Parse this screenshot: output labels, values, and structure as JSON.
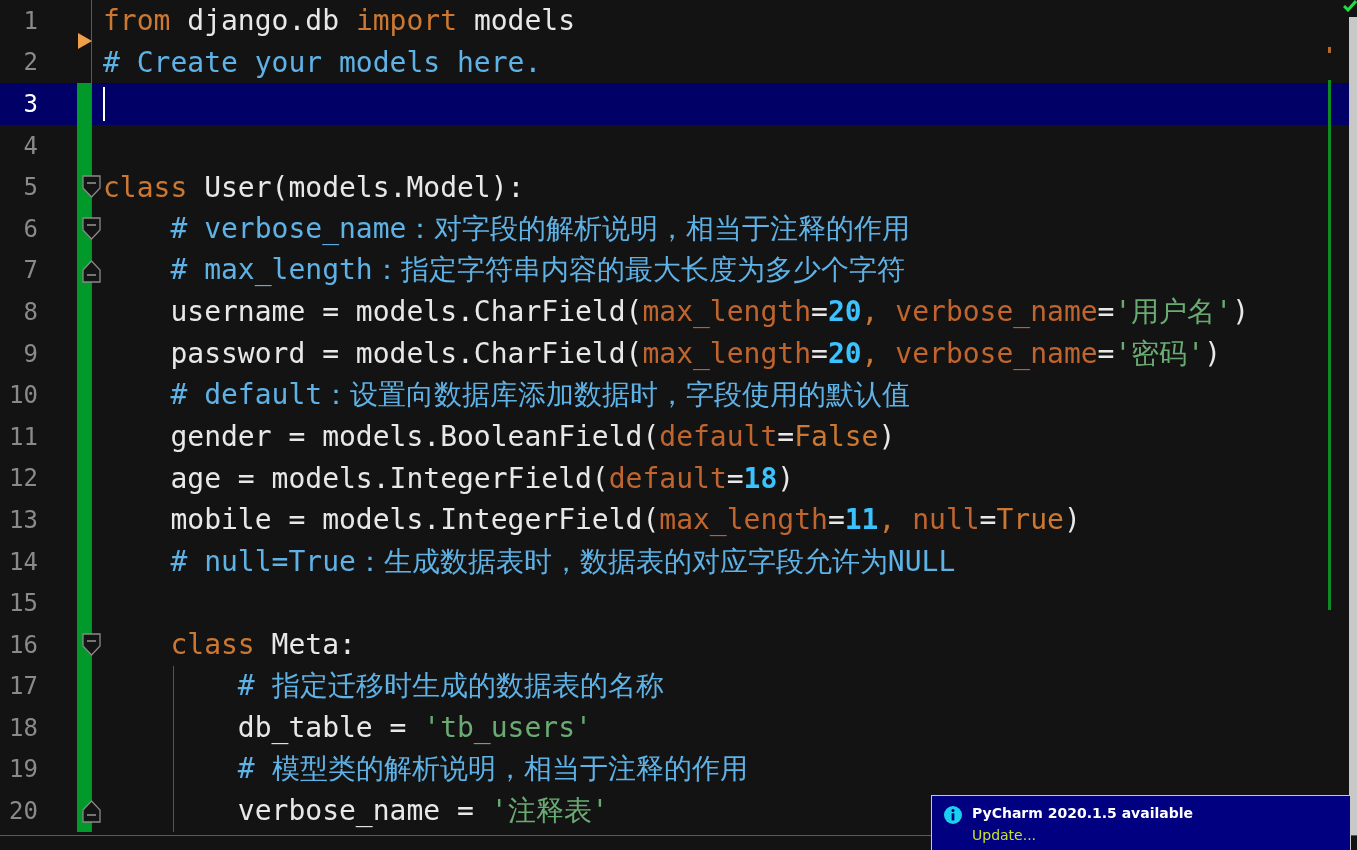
{
  "lines": [
    {
      "number": "1",
      "current": false,
      "changed": false,
      "fold_start": false,
      "fold_end": false,
      "guide": false,
      "tokens": [
        {
          "kind": "kw",
          "text": "from"
        },
        {
          "kind": "plain",
          "text": " django.db "
        },
        {
          "kind": "kw",
          "text": "import"
        },
        {
          "kind": "plain",
          "text": " models"
        }
      ]
    },
    {
      "number": "2",
      "current": false,
      "changed": false,
      "fold_start": false,
      "fold_end": false,
      "guide": false,
      "tokens": [
        {
          "kind": "cmt",
          "text": "# Create your models here."
        }
      ]
    },
    {
      "number": "3",
      "current": true,
      "changed": true,
      "fold_start": false,
      "fold_end": false,
      "guide": false
    },
    {
      "number": "4",
      "current": false,
      "changed": true,
      "fold_start": false,
      "fold_end": false,
      "guide": false
    },
    {
      "number": "5",
      "current": false,
      "changed": true,
      "fold_start": true,
      "fold_end": false,
      "guide": false,
      "tokens": [
        {
          "kind": "kw",
          "text": "class"
        },
        {
          "kind": "plain",
          "text": " User(models.Model):"
        }
      ]
    },
    {
      "number": "6",
      "current": false,
      "changed": true,
      "fold_start": true,
      "fold_end": false,
      "guide": false,
      "tokens": [
        {
          "kind": "cmt",
          "text": "    # verbose_name：对字段的解析说明，相当于注释的作用"
        }
      ]
    },
    {
      "number": "7",
      "current": false,
      "changed": true,
      "fold_start": false,
      "fold_end": true,
      "guide": false,
      "tokens": [
        {
          "kind": "cmt",
          "text": "    # max_length：指定字符串内容的最大长度为多少个字符"
        }
      ]
    },
    {
      "number": "8",
      "current": false,
      "changed": true,
      "fold_start": false,
      "fold_end": false,
      "guide": false,
      "tokens": [
        {
          "kind": "plain",
          "text": "    username = models.CharField("
        },
        {
          "kind": "param",
          "text": "max_length"
        },
        {
          "kind": "plain",
          "text": "="
        },
        {
          "kind": "num",
          "text": "20"
        },
        {
          "kind": "kw",
          "text": ", "
        },
        {
          "kind": "param",
          "text": "verbose_name"
        },
        {
          "kind": "plain",
          "text": "="
        },
        {
          "kind": "str",
          "text": "'用户名'"
        },
        {
          "kind": "plain",
          "text": ")"
        }
      ]
    },
    {
      "number": "9",
      "current": false,
      "changed": true,
      "fold_start": false,
      "fold_end": false,
      "guide": false,
      "tokens": [
        {
          "kind": "plain",
          "text": "    password = models.CharField("
        },
        {
          "kind": "param",
          "text": "max_length"
        },
        {
          "kind": "plain",
          "text": "="
        },
        {
          "kind": "num",
          "text": "20"
        },
        {
          "kind": "kw",
          "text": ", "
        },
        {
          "kind": "param",
          "text": "verbose_name"
        },
        {
          "kind": "plain",
          "text": "="
        },
        {
          "kind": "str",
          "text": "'密码'"
        },
        {
          "kind": "plain",
          "text": ")"
        }
      ]
    },
    {
      "number": "10",
      "current": false,
      "changed": true,
      "fold_start": false,
      "fold_end": false,
      "guide": false,
      "tokens": [
        {
          "kind": "cmt",
          "text": "    # default：设置向数据库添加数据时，字段使用的默认值"
        }
      ]
    },
    {
      "number": "11",
      "current": false,
      "changed": true,
      "fold_start": false,
      "fold_end": false,
      "guide": false,
      "tokens": [
        {
          "kind": "plain",
          "text": "    gender = models.BooleanField("
        },
        {
          "kind": "param",
          "text": "default"
        },
        {
          "kind": "plain",
          "text": "="
        },
        {
          "kind": "kw",
          "text": "False"
        },
        {
          "kind": "plain",
          "text": ")"
        }
      ]
    },
    {
      "number": "12",
      "current": false,
      "changed": true,
      "fold_start": false,
      "fold_end": false,
      "guide": false,
      "tokens": [
        {
          "kind": "plain",
          "text": "    age = models.IntegerField("
        },
        {
          "kind": "param",
          "text": "default"
        },
        {
          "kind": "plain",
          "text": "="
        },
        {
          "kind": "num",
          "text": "18"
        },
        {
          "kind": "plain",
          "text": ")"
        }
      ]
    },
    {
      "number": "13",
      "current": false,
      "changed": true,
      "fold_start": false,
      "fold_end": false,
      "guide": false,
      "tokens": [
        {
          "kind": "plain",
          "text": "    mobile = models.IntegerField("
        },
        {
          "kind": "param",
          "text": "max_length"
        },
        {
          "kind": "plain",
          "text": "="
        },
        {
          "kind": "num",
          "text": "11"
        },
        {
          "kind": "kw",
          "text": ", "
        },
        {
          "kind": "param",
          "text": "null"
        },
        {
          "kind": "plain",
          "text": "="
        },
        {
          "kind": "kw",
          "text": "True"
        },
        {
          "kind": "plain",
          "text": ")"
        }
      ]
    },
    {
      "number": "14",
      "current": false,
      "changed": true,
      "fold_start": false,
      "fold_end": false,
      "guide": false,
      "tokens": [
        {
          "kind": "cmt",
          "text": "    # null=True：生成数据表时，数据表的对应字段允许为NULL"
        }
      ]
    },
    {
      "number": "15",
      "current": false,
      "changed": true,
      "fold_start": false,
      "fold_end": false,
      "guide": false
    },
    {
      "number": "16",
      "current": false,
      "changed": true,
      "fold_start": true,
      "fold_end": false,
      "guide": false,
      "tokens": [
        {
          "kind": "kw",
          "text": "    class"
        },
        {
          "kind": "plain",
          "text": " Meta:"
        }
      ]
    },
    {
      "number": "17",
      "current": false,
      "changed": true,
      "fold_start": false,
      "fold_end": false,
      "guide": true,
      "tokens": [
        {
          "kind": "cmt",
          "text": "        # 指定迁移时生成的数据表的名称"
        }
      ]
    },
    {
      "number": "18",
      "current": false,
      "changed": true,
      "fold_start": false,
      "fold_end": false,
      "guide": true,
      "tokens": [
        {
          "kind": "plain",
          "text": "        db_table = "
        },
        {
          "kind": "str",
          "text": "'tb_users'"
        }
      ]
    },
    {
      "number": "19",
      "current": false,
      "changed": true,
      "fold_start": false,
      "fold_end": false,
      "guide": true,
      "tokens": [
        {
          "kind": "cmt",
          "text": "        # 模型类的解析说明，相当于注释的作用"
        }
      ]
    },
    {
      "number": "20",
      "current": false,
      "changed": true,
      "fold_start": false,
      "fold_end": true,
      "guide": true,
      "tokens": [
        {
          "kind": "plain",
          "text": "        verbose_name = "
        },
        {
          "kind": "str",
          "text": "'注释表'"
        }
      ]
    }
  ],
  "notification": {
    "title": "PyCharm 2020.1.5 available",
    "link": "Update..."
  }
}
